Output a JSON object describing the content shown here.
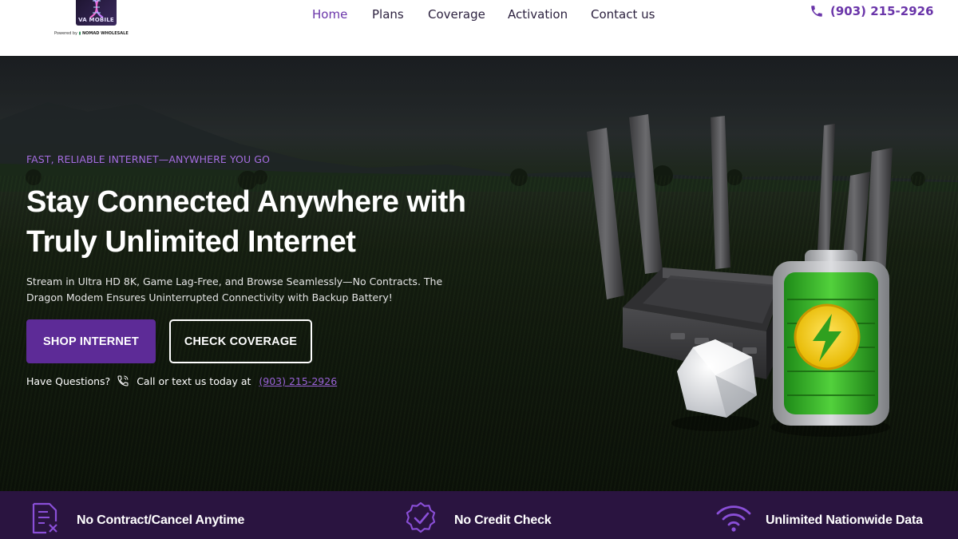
{
  "brand": {
    "name": "VA MOBILE",
    "powered_by": "Powered by",
    "partner": "NOMAD WHOLESALE"
  },
  "nav": {
    "items": [
      {
        "label": "Home",
        "active": true
      },
      {
        "label": "Plans",
        "active": false
      },
      {
        "label": "Coverage",
        "active": false
      },
      {
        "label": "Activation",
        "active": false
      },
      {
        "label": "Contact us",
        "active": false
      }
    ]
  },
  "header_phone": {
    "icon": "phone-icon",
    "number": "(903) 215-2926"
  },
  "hero": {
    "eyebrow": "FAST, RELIABLE INTERNET—ANYWHERE YOU GO",
    "headline_line1": "Stay Connected Anywhere with",
    "headline_line2": "Truly Unlimited Internet",
    "subtext_line1": "Stream in Ultra HD 8K, Game Lag-Free, and Browse Seamlessly—No Contracts. The",
    "subtext_line2": "Dragon Modem Ensures Uninterrupted Connectivity with Backup Battery!",
    "primary_button": "SHOP INTERNET",
    "secondary_button": "CHECK COVERAGE",
    "questions_label": "Have Questions?",
    "call_text": "Call or text us today at",
    "phone_link": "(903) 215-2926"
  },
  "features": [
    {
      "icon": "document-cancel-icon",
      "label": "No Contract/Cancel Anytime"
    },
    {
      "icon": "verified-badge-icon",
      "label": "No Credit Check"
    },
    {
      "icon": "wifi-icon",
      "label": "Unlimited Nationwide Data"
    }
  ],
  "colors": {
    "accent": "#6a35a9",
    "button": "#5d2b97",
    "eyebrow": "#a46ddf",
    "feature_bar": "#2a1440",
    "battery_green": "#3fb82e"
  }
}
